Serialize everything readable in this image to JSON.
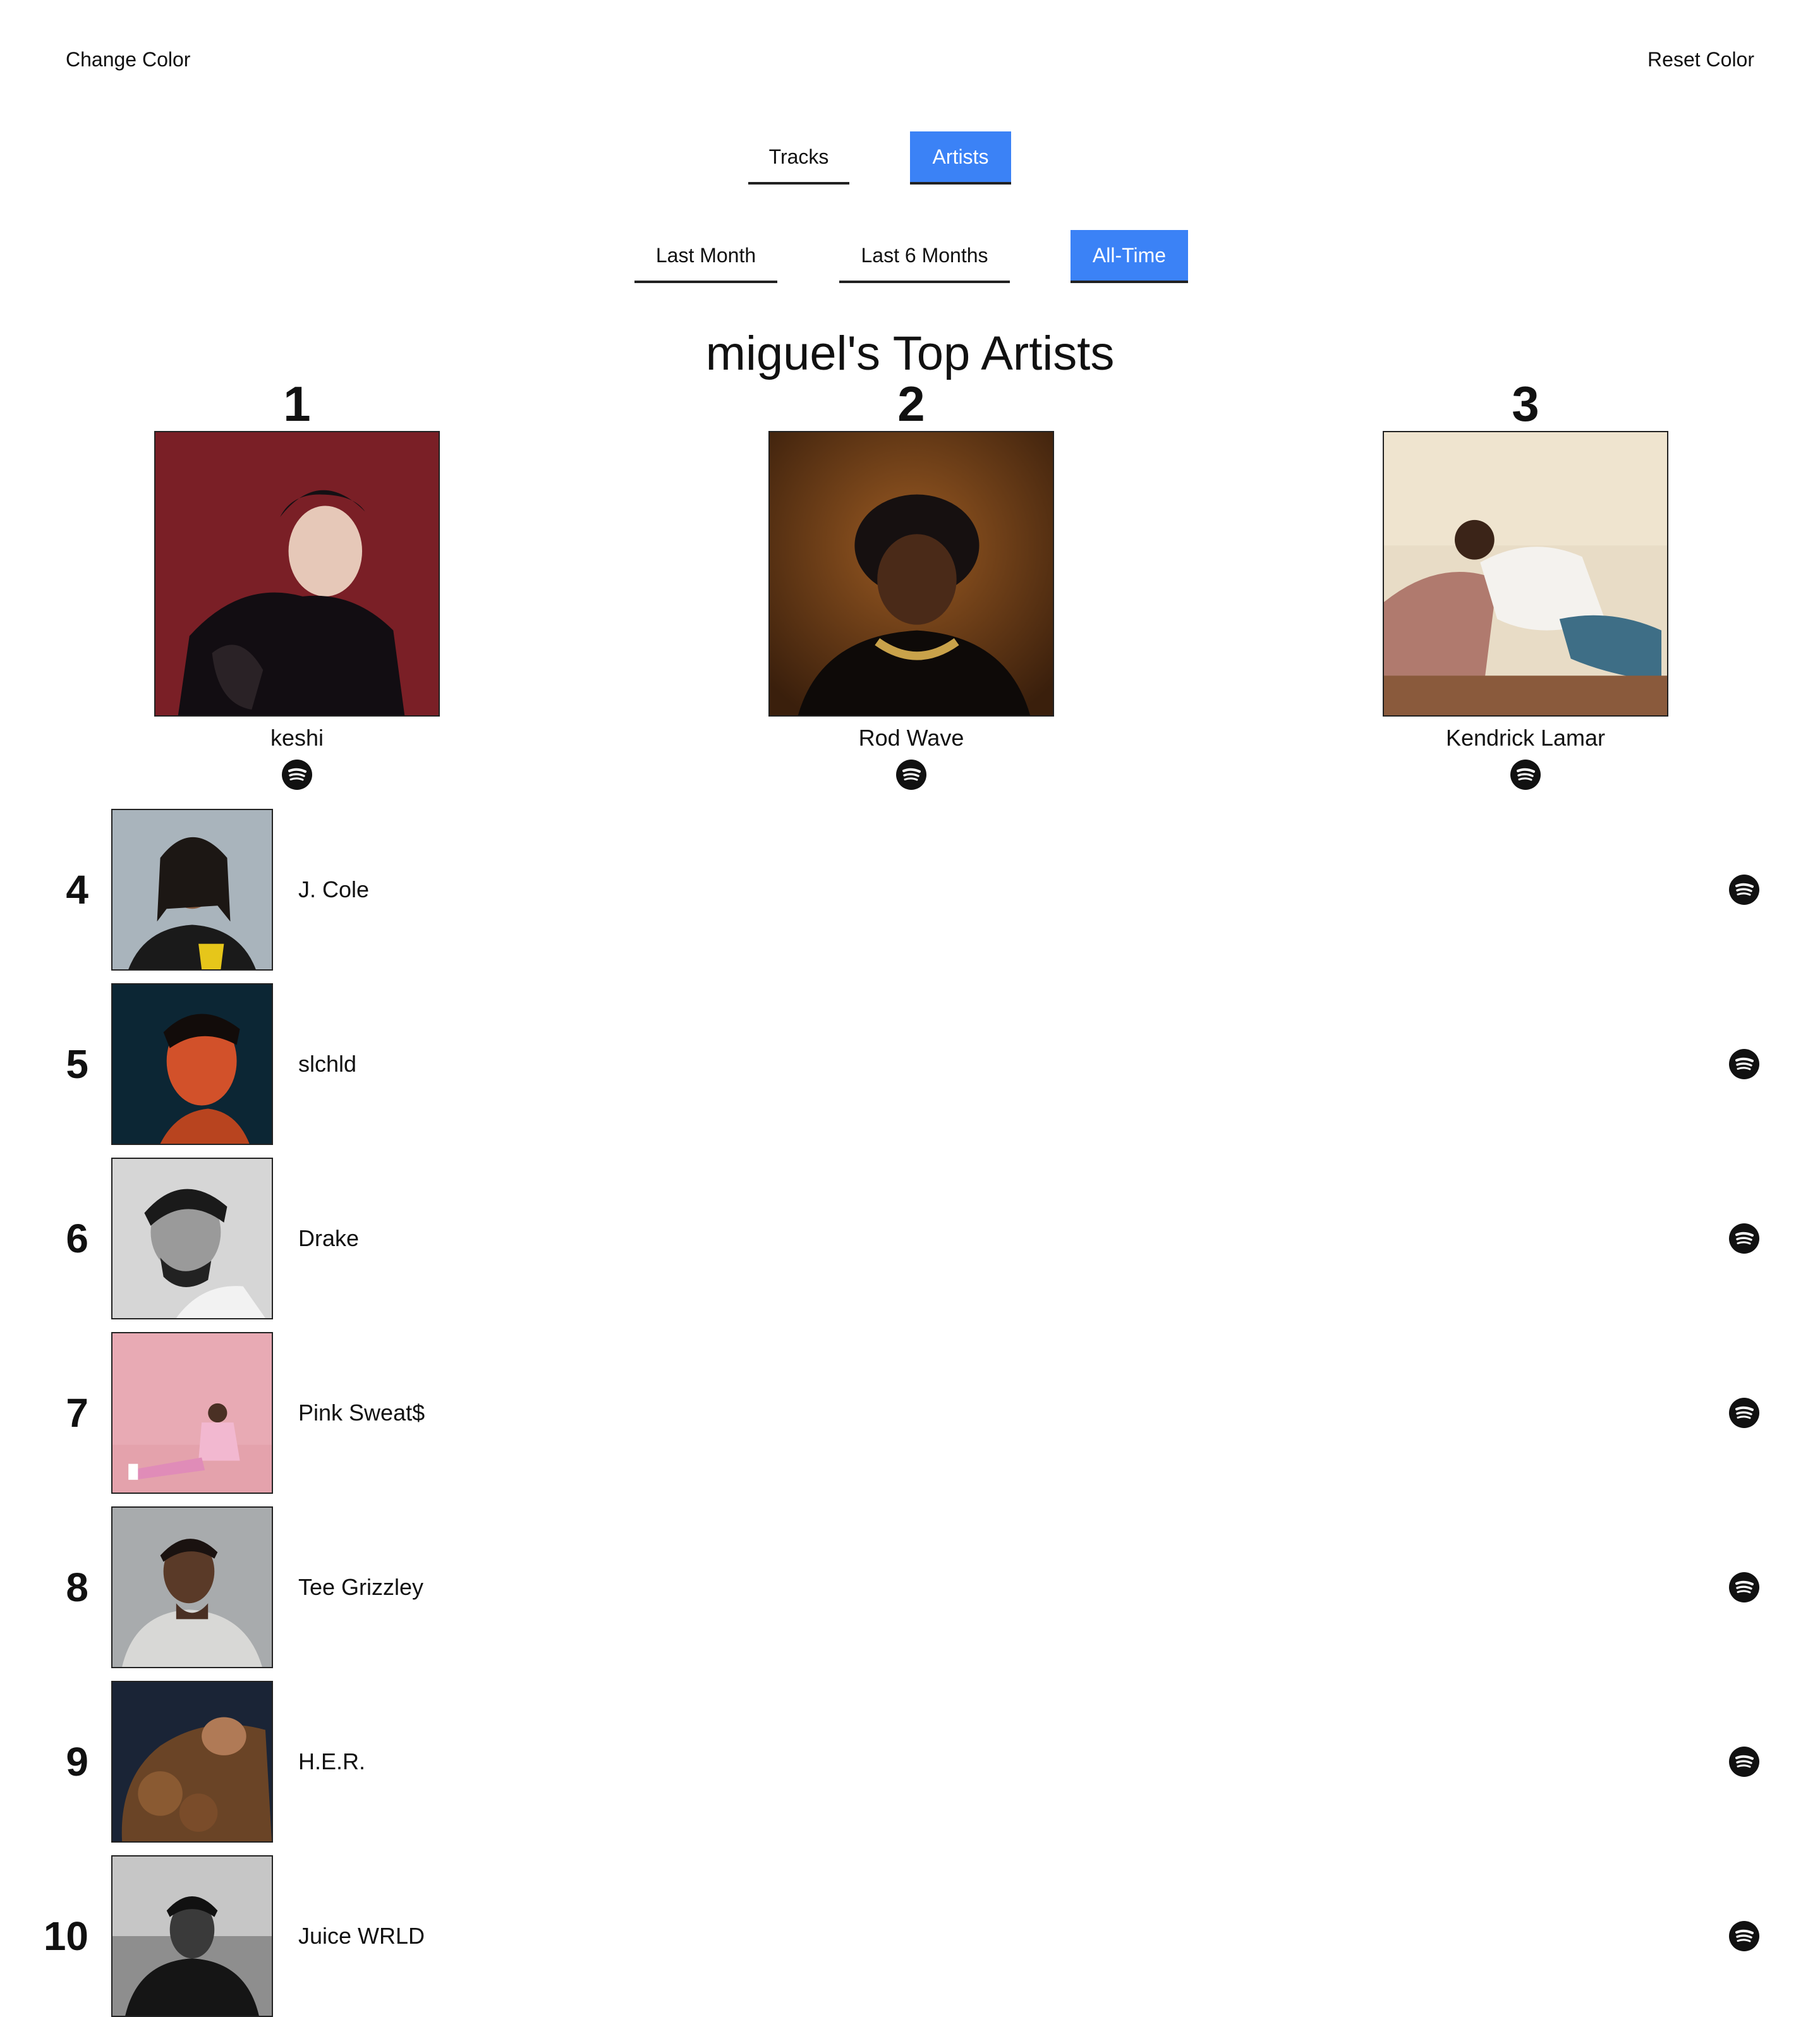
{
  "header": {
    "change_color": "Change Color",
    "reset_color": "Reset Color"
  },
  "tabs": {
    "tracks": "Tracks",
    "artists": "Artists",
    "active": "Artists"
  },
  "ranges": {
    "last_month": "Last Month",
    "last_6_months": "Last 6 Months",
    "all_time": "All-Time",
    "active": "All-Time"
  },
  "title": "miguel's Top Artists",
  "accent_color": "#3b82f6",
  "icon": "spotify-icon",
  "podium": [
    {
      "rank": "1",
      "name": "keshi"
    },
    {
      "rank": "2",
      "name": "Rod Wave"
    },
    {
      "rank": "3",
      "name": "Kendrick Lamar"
    }
  ],
  "list": [
    {
      "rank": "4",
      "name": "J. Cole"
    },
    {
      "rank": "5",
      "name": "slchld"
    },
    {
      "rank": "6",
      "name": "Drake"
    },
    {
      "rank": "7",
      "name": "Pink Sweat$"
    },
    {
      "rank": "8",
      "name": "Tee Grizzley"
    },
    {
      "rank": "9",
      "name": "H.E.R."
    },
    {
      "rank": "10",
      "name": "Juice WRLD"
    }
  ]
}
